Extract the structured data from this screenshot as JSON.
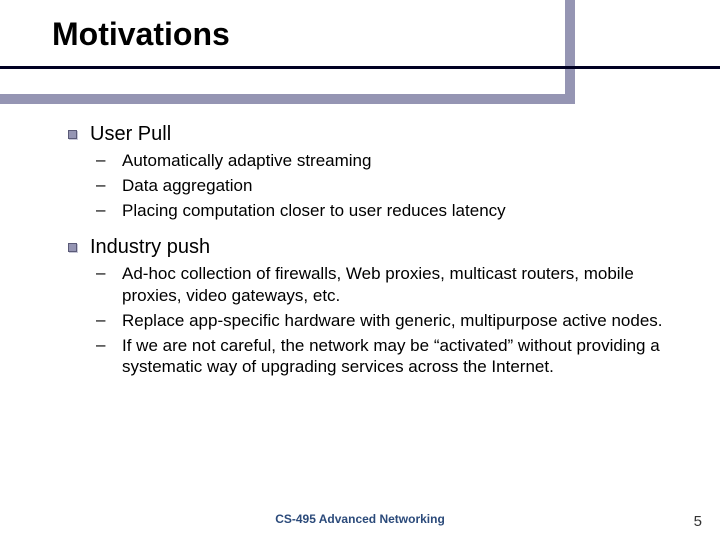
{
  "title": "Motivations",
  "bullets": [
    {
      "label": "User Pull",
      "subs": [
        "Automatically adaptive streaming",
        "Data aggregation",
        "Placing computation closer to user reduces latency"
      ]
    },
    {
      "label": "Industry push",
      "subs": [
        "Ad-hoc collection of firewalls, Web proxies, multicast routers, mobile proxies, video gateways, etc.",
        "Replace app-specific hardware with generic, multipurpose active nodes.",
        "If we are not careful, the network may be “activated” without providing a systematic way of upgrading services across the Internet."
      ]
    }
  ],
  "footer": "CS-495 Advanced Networking",
  "page": "5"
}
